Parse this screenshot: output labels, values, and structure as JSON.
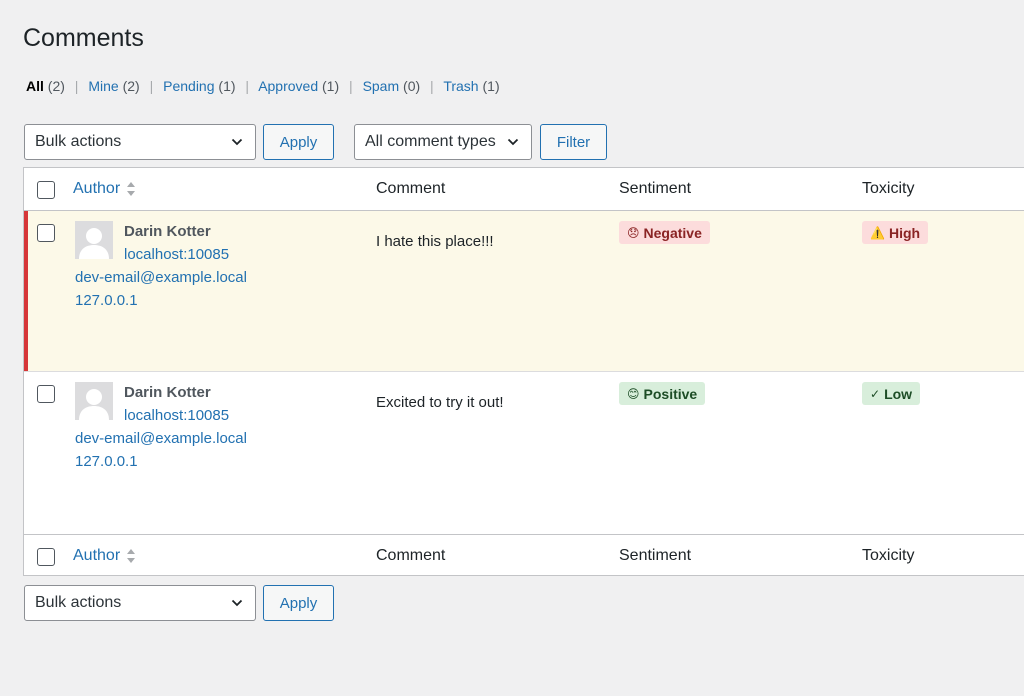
{
  "page": {
    "title": "Comments"
  },
  "filters": [
    {
      "label": "All",
      "count": "(2)",
      "current": true
    },
    {
      "label": "Mine",
      "count": "(2)"
    },
    {
      "label": "Pending",
      "count": "(1)"
    },
    {
      "label": "Approved",
      "count": "(1)"
    },
    {
      "label": "Spam",
      "count": "(0)"
    },
    {
      "label": "Trash",
      "count": "(1)"
    }
  ],
  "toolbar_top": {
    "bulk_actions": "Bulk actions",
    "apply": "Apply",
    "comment_types": "All comment types",
    "filter": "Filter"
  },
  "toolbar_bottom": {
    "bulk_actions": "Bulk actions",
    "apply": "Apply"
  },
  "table": {
    "columns": {
      "author": "Author",
      "comment": "Comment",
      "sentiment": "Sentiment",
      "toxicity": "Toxicity"
    },
    "rows": [
      {
        "author": "Darin Kotter",
        "url": "localhost:10085",
        "email": "dev-email@example.local",
        "ip": "127.0.0.1",
        "comment": "I hate this place!!!",
        "sentiment": {
          "icon": "😞",
          "label": "Negative",
          "icon_name": "frown-emoji-icon"
        },
        "toxicity": {
          "icon": "⚠️",
          "label": "High",
          "icon_name": "warning-icon"
        }
      },
      {
        "author": "Darin Kotter",
        "url": "localhost:10085",
        "email": "dev-email@example.local",
        "ip": "127.0.0.1",
        "comment": "Excited to try it out!",
        "sentiment": {
          "icon": "😊",
          "label": "Positive",
          "icon_name": "smile-emoji-icon"
        },
        "toxicity": {
          "icon": "✓",
          "label": "Low",
          "icon_name": "check-icon"
        }
      }
    ]
  },
  "colors": {
    "link": "#2271b1",
    "unapproved_row_bg": "#fcf9e8",
    "unapproved_row_bar": "#d63638",
    "negative_bg": "#fcdcdc",
    "positive_bg": "#d8eedb"
  }
}
